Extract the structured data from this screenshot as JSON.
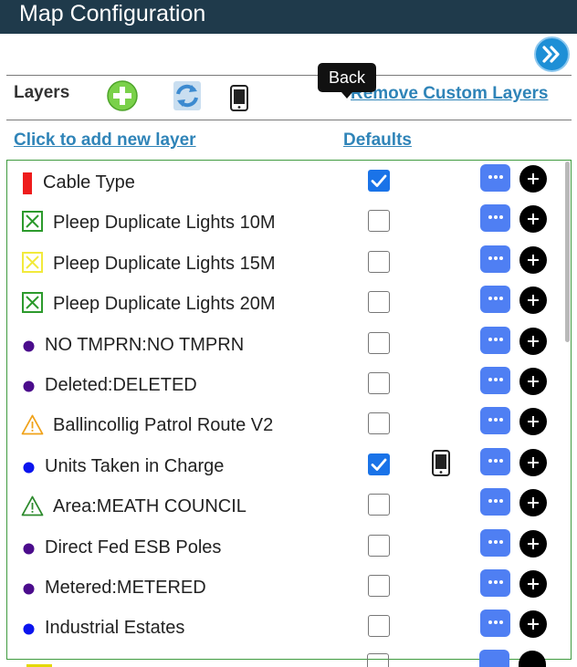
{
  "header": {
    "title": "Map Configuration"
  },
  "toolbar": {
    "layers_label": "Layers",
    "tooltip": "Back",
    "remove_custom_layers": "Remove Custom Layers",
    "add_new_layer": "Click to add new layer",
    "defaults": "Defaults"
  },
  "colors": {
    "title_bar": "#1f3a4b",
    "link": "#2f84b8",
    "checkbox_checked": "#1a73e8",
    "more_button": "#4f7ff3",
    "panel_border": "#3f9b3f"
  },
  "layers": [
    {
      "label": "Cable Type",
      "icon": "red-bar-icon",
      "icon_color": "#ee1c1c",
      "checked": true,
      "mobile": false
    },
    {
      "label": "Pleep Duplicate Lights 10M",
      "icon": "boxed-x-icon",
      "icon_color": "#2c9a2c",
      "checked": false,
      "mobile": false
    },
    {
      "label": "Pleep Duplicate Lights 15M",
      "icon": "boxed-x-icon",
      "icon_color": "#f2ea3c",
      "checked": false,
      "mobile": false
    },
    {
      "label": "Pleep Duplicate Lights 20M",
      "icon": "boxed-x-icon",
      "icon_color": "#2c9a2c",
      "checked": false,
      "mobile": false
    },
    {
      "label": "NO TMPRN:NO TMPRN",
      "icon": "dot-icon",
      "icon_color": "#4b0c8c",
      "checked": false,
      "mobile": false
    },
    {
      "label": "Deleted:DELETED",
      "icon": "dot-icon",
      "icon_color": "#4b0c8c",
      "checked": false,
      "mobile": false
    },
    {
      "label": "Ballincollig Patrol Route V2",
      "icon": "warning-triangle-icon",
      "icon_color": "#f0a21a",
      "checked": false,
      "mobile": false
    },
    {
      "label": "Units Taken in Charge",
      "icon": "dot-icon",
      "icon_color": "#0b14ee",
      "checked": true,
      "mobile": true
    },
    {
      "label": "Area:MEATH COUNCIL",
      "icon": "warning-triangle-icon",
      "icon_color": "#2c8a2c",
      "checked": false,
      "mobile": false
    },
    {
      "label": "Direct Fed ESB Poles",
      "icon": "dot-icon",
      "icon_color": "#4b0c8c",
      "checked": false,
      "mobile": false
    },
    {
      "label": "Metered:METERED",
      "icon": "dot-icon",
      "icon_color": "#4b0c8c",
      "checked": false,
      "mobile": false
    },
    {
      "label": "Industrial Estates",
      "icon": "dot-icon",
      "icon_color": "#0b14ee",
      "checked": false,
      "mobile": false
    }
  ]
}
